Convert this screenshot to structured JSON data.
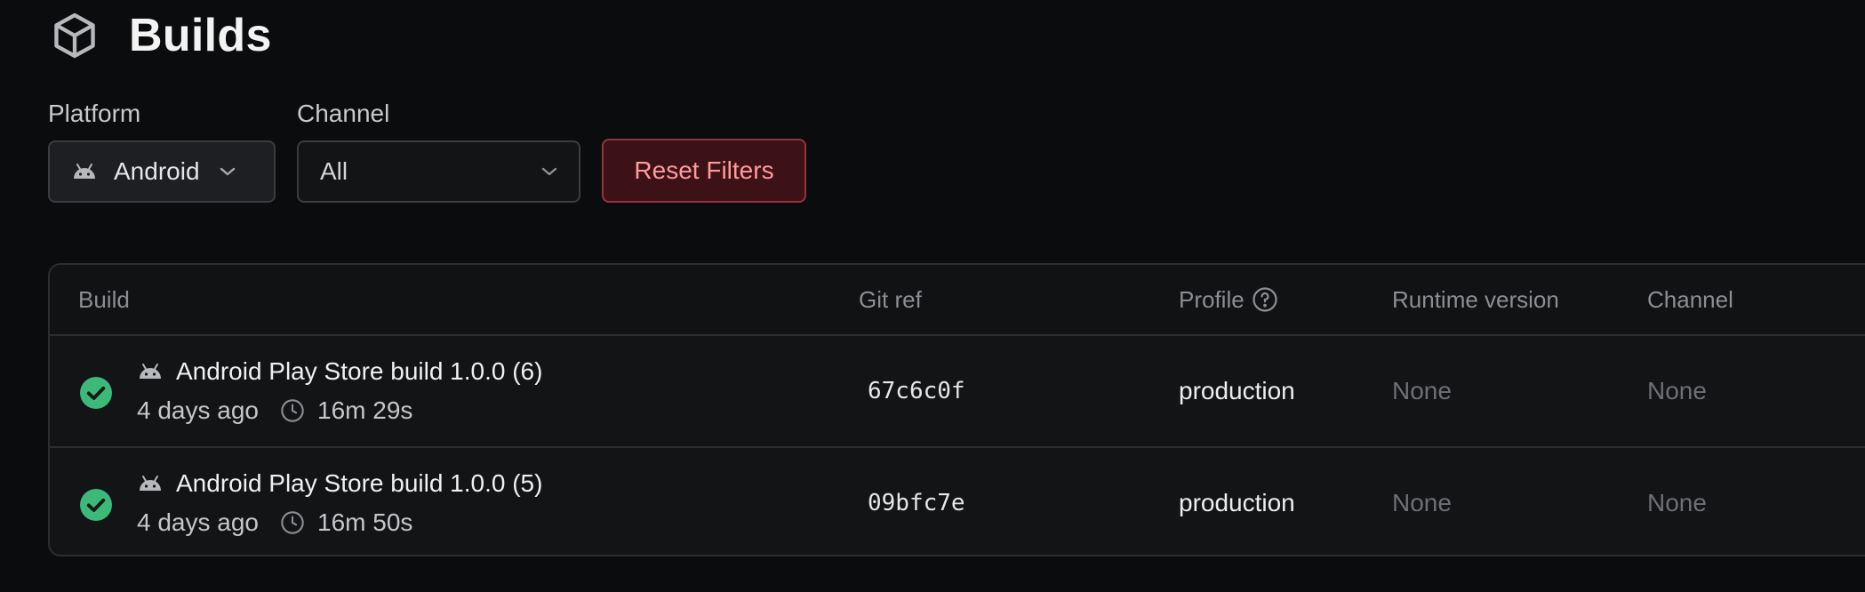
{
  "page": {
    "title": "Builds",
    "icon": "cube-icon"
  },
  "filters": {
    "platform": {
      "label": "Platform",
      "value": "Android",
      "icon": "android-icon"
    },
    "channel": {
      "label": "Channel",
      "value": "All"
    },
    "reset_label": "Reset Filters"
  },
  "table": {
    "headers": {
      "build": "Build",
      "git_ref": "Git ref",
      "profile": "Profile",
      "runtime_version": "Runtime version",
      "channel": "Channel"
    },
    "rows": [
      {
        "status": "success",
        "title": "Android Play Store build 1.0.0 (6)",
        "age": "4 days ago",
        "duration": "16m 29s",
        "git_ref": "67c6c0f",
        "profile": "production",
        "runtime_version": "None",
        "channel": "None"
      },
      {
        "status": "success",
        "title": "Android Play Store build 1.0.0 (5)",
        "age": "4 days ago",
        "duration": "16m 50s",
        "git_ref": "09bfc7e",
        "profile": "production",
        "runtime_version": "None",
        "channel": "None"
      }
    ]
  },
  "colors": {
    "background": "#0b0c0e",
    "success": "#3cb878",
    "danger_text": "#ff9a9d",
    "danger_border": "#93333c"
  }
}
